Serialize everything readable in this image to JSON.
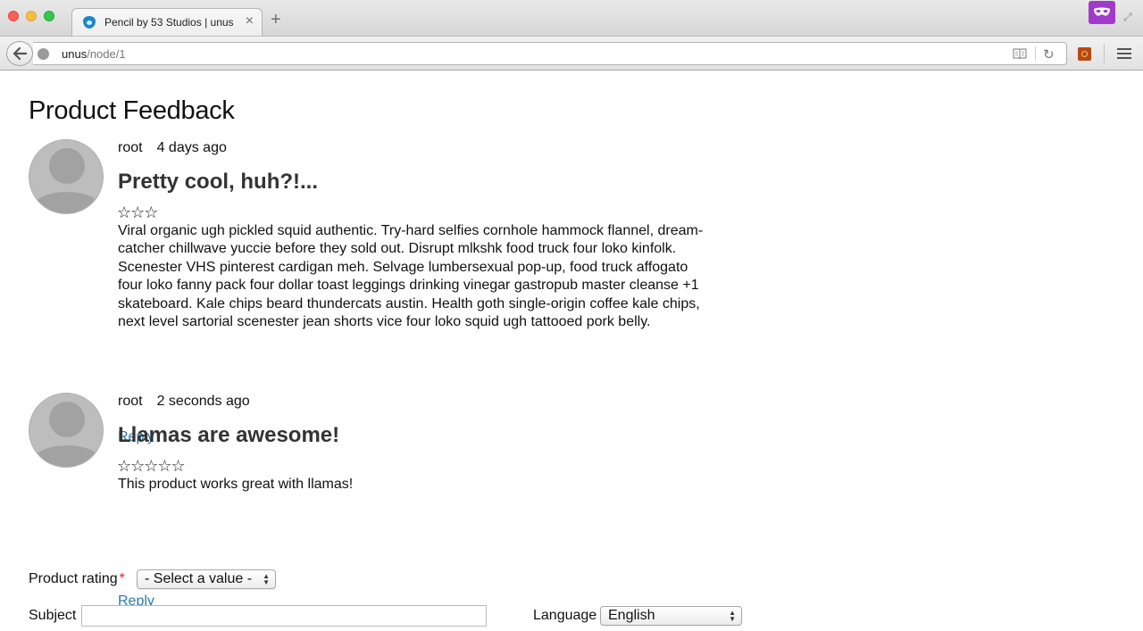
{
  "browser": {
    "tab_title": "Pencil by 53 Studios | unus",
    "tab_close": "×",
    "new_tab": "+",
    "url_host": "unus",
    "url_path": "/node/1"
  },
  "page": {
    "title": "Product Feedback"
  },
  "comments": [
    {
      "author": "root",
      "date": "4 days ago",
      "subject": "Pretty cool, huh?!...",
      "stars": "☆☆☆",
      "body": "Viral organic ugh pickled squid authentic. Try-hard selfies cornhole hammock flannel, dream-catcher chillwave yuccie before they sold out. Disrupt mlkshk food truck four loko kinfolk. Scenester VHS pinterest cardigan meh. Selvage lumbersexual pop-up, food truck affogato four loko fanny pack four dollar toast leggings drinking vinegar gastropub master cleanse +1 skateboard. Kale chips beard thundercats austin. Health goth single-origin coffee kale chips, next level sartorial scenester jean shorts vice four loko squid ugh tattooed pork belly.",
      "reply": "Reply"
    },
    {
      "author": "root",
      "date": "2 seconds ago",
      "subject": "Llamas are awesome!",
      "stars": "☆☆☆☆☆",
      "body": "This product works great with llamas!",
      "reply": "Reply"
    }
  ],
  "form": {
    "rating_label": "Product rating",
    "required_mark": "*",
    "rating_value": "- Select a value -",
    "subject_label": "Subject",
    "subject_value": "",
    "language_label": "Language",
    "language_value": "English"
  },
  "colors": {
    "link": "#2a7aa8",
    "required": "#dd2222",
    "extension": "#a13acb"
  }
}
